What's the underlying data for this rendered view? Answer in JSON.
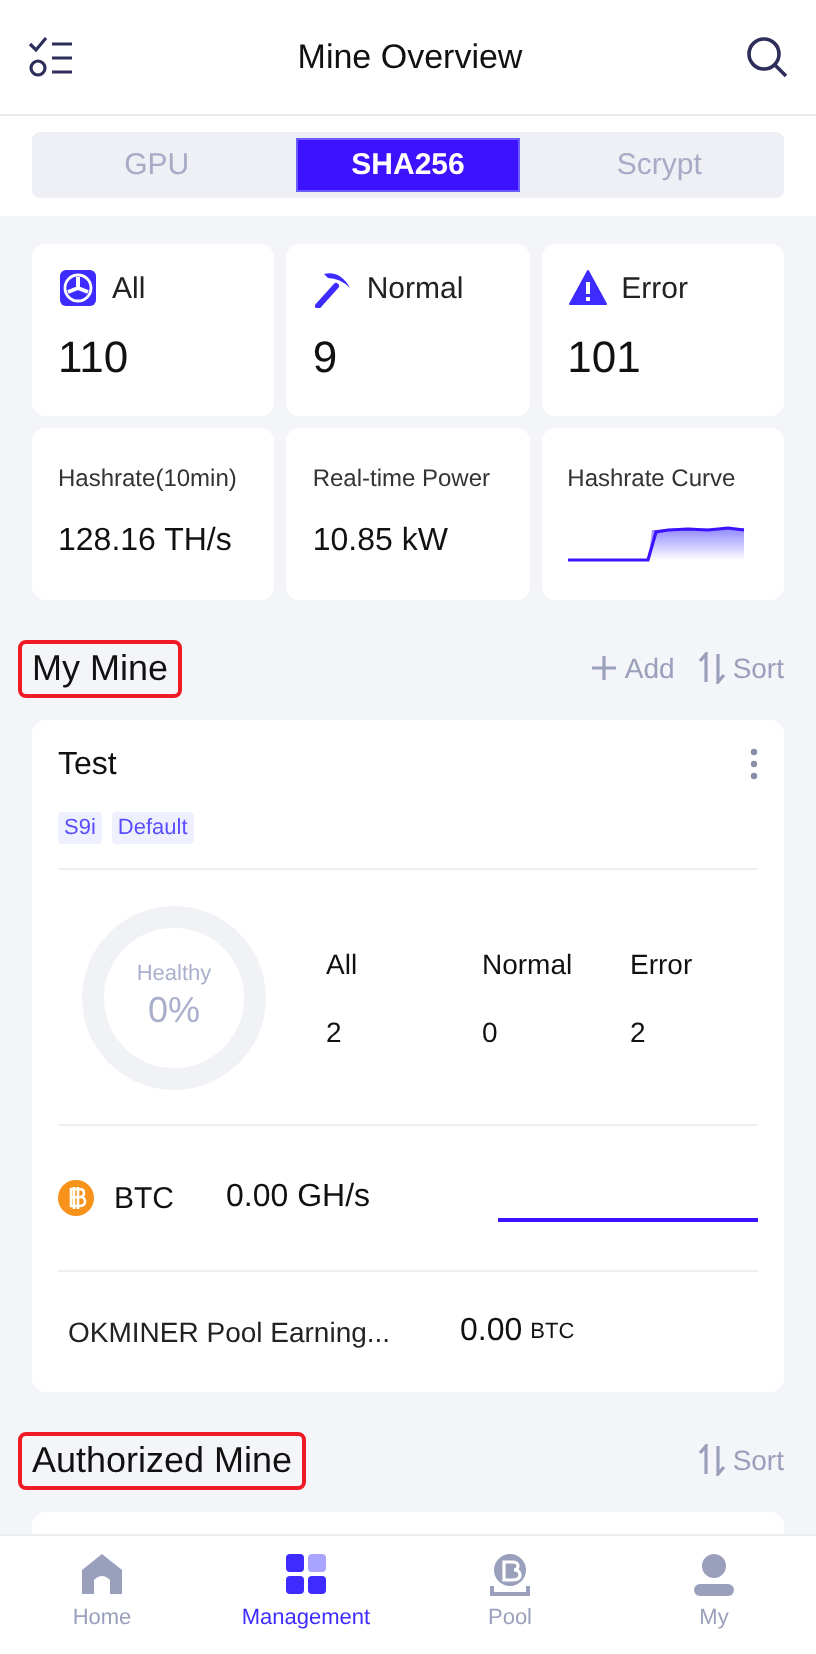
{
  "header": {
    "title": "Mine Overview"
  },
  "algo_tabs": [
    {
      "label": "GPU",
      "selected": false
    },
    {
      "label": "SHA256",
      "selected": true
    },
    {
      "label": "Scrypt",
      "selected": false
    }
  ],
  "status_cards": [
    {
      "kind": "all",
      "label": "All",
      "value": "110"
    },
    {
      "kind": "normal",
      "label": "Normal",
      "value": "9"
    },
    {
      "kind": "error",
      "label": "Error",
      "value": "101"
    }
  ],
  "metric_cards": [
    {
      "kind": "text",
      "label": "Hashrate(10min)",
      "value": "128.16 TH/s"
    },
    {
      "kind": "text",
      "label": "Real-time Power",
      "value": "10.85 kW"
    },
    {
      "kind": "curve",
      "label": "Hashrate Curve"
    }
  ],
  "my_mine": {
    "title": "My Mine",
    "highlighted": true,
    "actions": [
      {
        "kind": "add",
        "label": "Add"
      },
      {
        "kind": "sort",
        "label": "Sort"
      }
    ],
    "cards": [
      {
        "name": "Test",
        "tags": [
          "S9i",
          "Default"
        ],
        "health": {
          "label": "Healthy",
          "reading": "0%",
          "level": 0
        },
        "counts": [
          {
            "label": "All",
            "value": "2"
          },
          {
            "label": "Normal",
            "value": "0"
          },
          {
            "label": "Error",
            "value": "2"
          }
        ],
        "coin": {
          "name": "BTC",
          "hashrate": "0.00 GH/s"
        },
        "earnings": {
          "label": "OKMINER Pool Earning...",
          "amount": "0.00",
          "unit": "BTC"
        }
      }
    ]
  },
  "authorized_mine": {
    "title": "Authorized Mine",
    "highlighted": true,
    "actions": [
      {
        "kind": "sort",
        "label": "Sort"
      }
    ]
  },
  "bottom_nav": [
    {
      "kind": "home",
      "label": "Home",
      "selected": false
    },
    {
      "kind": "management",
      "label": "Management",
      "selected": true
    },
    {
      "kind": "pool",
      "label": "Pool",
      "selected": false
    },
    {
      "kind": "profile",
      "label": "My",
      "selected": false
    }
  ]
}
